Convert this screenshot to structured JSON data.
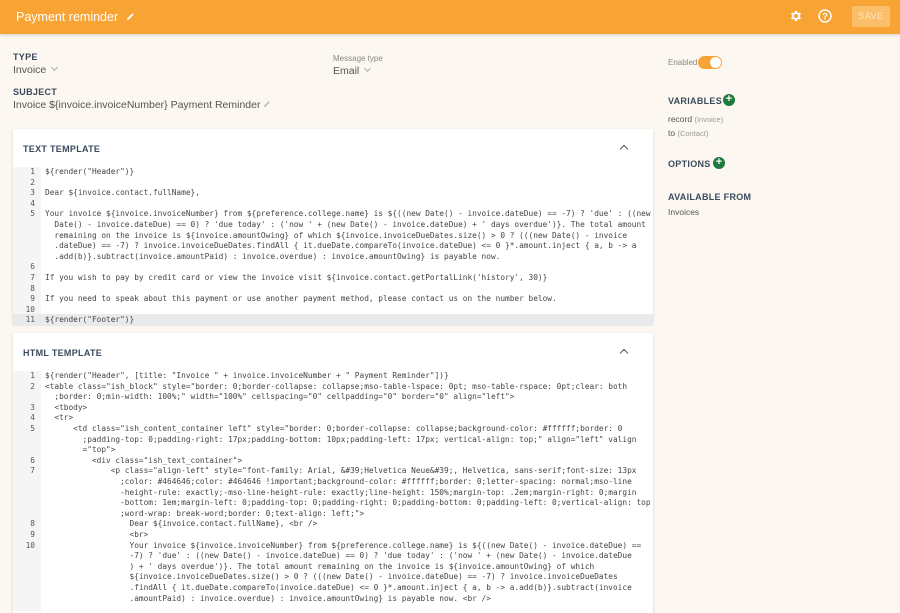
{
  "header": {
    "title": "Payment reminder",
    "save_label": "SAVE"
  },
  "type": {
    "label": "TYPE",
    "value": "Invoice"
  },
  "message_type": {
    "label": "Message type",
    "value": "Email"
  },
  "subject": {
    "label": "SUBJECT",
    "value": "Invoice ${invoice.invoiceNumber} Payment Reminder"
  },
  "enabled": {
    "label": "Enabled",
    "on": true
  },
  "variables": {
    "label": "VARIABLES",
    "items": [
      {
        "name": "record",
        "type": "(Invoice)"
      },
      {
        "name": "to",
        "type": "(Contact)"
      }
    ]
  },
  "options": {
    "label": "OPTIONS"
  },
  "available_from": {
    "label": "AVAILABLE FROM",
    "value": "Invoices"
  },
  "text_template": {
    "title": "TEXT TEMPLATE",
    "lines": [
      {
        "n": "1",
        "t": "${render(\"Header\")}"
      },
      {
        "n": "2",
        "t": ""
      },
      {
        "n": "3",
        "t": "Dear ${invoice.contact.fullName},"
      },
      {
        "n": "4",
        "t": ""
      },
      {
        "n": "5",
        "t": "Your invoice ${invoice.invoiceNumber} from ${preference.college.name} is ${((new Date() - invoice.dateDue) == -7) ? 'due' : ((new"
      },
      {
        "n": "",
        "t": "  Date() - invoice.dateDue) == 0) ? 'due today' : ('now ' + (new Date() - invoice.dateDue) + ' days overdue')}. The total amount"
      },
      {
        "n": "",
        "t": "  remaining on the invoice is ${invoice.amountOwing} of which ${invoice.invoiceDueDates.size() > 0 ? (((new Date() - invoice"
      },
      {
        "n": "",
        "t": "  .dateDue) == -7) ? invoice.invoiceDueDates.findAll { it.dueDate.compareTo(invoice.dateDue) <= 0 }*.amount.inject { a, b -> a"
      },
      {
        "n": "",
        "t": "  .add(b)}.subtract(invoice.amountPaid) : invoice.overdue) : invoice.amountOwing} is payable now."
      },
      {
        "n": "6",
        "t": ""
      },
      {
        "n": "7",
        "t": "If you wish to pay by credit card or view the invoice visit ${invoice.contact.getPortalLink('history', 30)}"
      },
      {
        "n": "8",
        "t": ""
      },
      {
        "n": "9",
        "t": "If you need to speak about this payment or use another payment method, please contact us on the number below."
      },
      {
        "n": "10",
        "t": ""
      },
      {
        "n": "11",
        "t": "${render(\"Footer\")}"
      }
    ]
  },
  "html_template": {
    "title": "HTML TEMPLATE",
    "lines": [
      {
        "n": "1",
        "t": "${render(\"Header\", [title: \"Invoice \" + invoice.invoiceNumber + \" Payment Reminder\"])}"
      },
      {
        "n": "2",
        "t": "<table class=\"ish_block\" style=\"border: 0;border-collapse: collapse;mso-table-lspace: 0pt; mso-table-rspace: 0pt;clear: both"
      },
      {
        "n": "",
        "t": "  ;border: 0;min-width: 100%;\" width=\"100%\" cellspacing=\"0\" cellpadding=\"0\" border=\"0\" align=\"left\">"
      },
      {
        "n": "3",
        "t": "  <tbody>"
      },
      {
        "n": "4",
        "t": "  <tr>"
      },
      {
        "n": "5",
        "t": "      <td class=\"ish_content_container left\" style=\"border: 0;border-collapse: collapse;background-color: #ffffff;border: 0"
      },
      {
        "n": "",
        "t": "        ;padding-top: 0;padding-right: 17px;padding-bottom: 10px;padding-left: 17px; vertical-align: top;\" align=\"left\" valign"
      },
      {
        "n": "",
        "t": "        =\"top\">"
      },
      {
        "n": "6",
        "t": "          <div class=\"ish_text_container\">"
      },
      {
        "n": "7",
        "t": "              <p class=\"align-left\" style=\"font-family: Arial, &#39;Helvetica Neue&#39;, Helvetica, sans-serif;font-size: 13px"
      },
      {
        "n": "",
        "t": "                ;color: #464646;color: #464646 !important;background-color: #ffffff;border: 0;letter-spacing: normal;mso-line"
      },
      {
        "n": "",
        "t": "                -height-rule: exactly;-mso-line-height-rule: exactly;line-height: 150%;margin-top: .2em;margin-right: 0;margin"
      },
      {
        "n": "",
        "t": "                -bottom: 1em;margin-left: 0;padding-top: 0;padding-right: 0;padding-bottom: 0;padding-left: 0;vertical-align: top"
      },
      {
        "n": "",
        "t": "                ;word-wrap: break-word;border: 0;text-align: left;\">"
      },
      {
        "n": "8",
        "t": "                  Dear ${invoice.contact.fullName}, <br />"
      },
      {
        "n": "9",
        "t": "                  <br>"
      },
      {
        "n": "10",
        "t": "                  Your invoice ${invoice.invoiceNumber} from ${preference.college.name} is ${((new Date() - invoice.dateDue) =="
      },
      {
        "n": "",
        "t": "                  -7) ? 'due' : ((new Date() - invoice.dateDue) == 0) ? 'due today' : ('now ' + (new Date() - invoice.dateDue"
      },
      {
        "n": "",
        "t": "                  ) + ' days overdue')}. The total amount remaining on the invoice is ${invoice.amountOwing} of which"
      },
      {
        "n": "",
        "t": "                  ${invoice.invoiceDueDates.size() > 0 ? (((new Date() - invoice.dateDue) == -7) ? invoice.invoiceDueDates"
      },
      {
        "n": "",
        "t": "                  .findAll { it.dueDate.compareTo(invoice.dateDue) <= 0 }*.amount.inject { a, b -> a.add(b)}.subtract(invoice"
      },
      {
        "n": "",
        "t": "                  .amountPaid) : invoice.overdue) : invoice.amountOwing} is payable now. <br />"
      }
    ]
  }
}
